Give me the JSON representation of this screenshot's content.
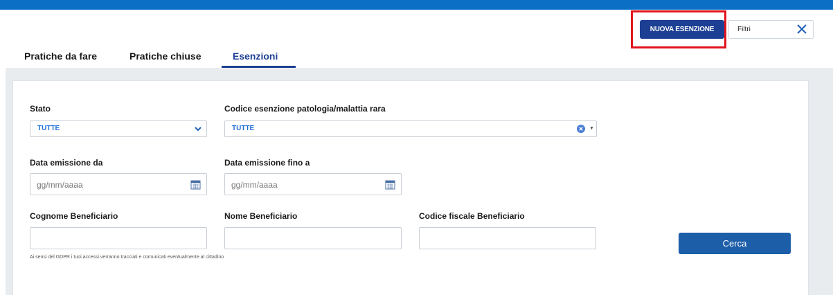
{
  "header": {
    "new_button_label": "NUOVA ESENZIONE",
    "filter_label": "Filtri"
  },
  "tabs": [
    {
      "label": "Pratiche da fare",
      "active": false
    },
    {
      "label": "Pratiche chiuse",
      "active": false
    },
    {
      "label": "Esenzioni",
      "active": true
    }
  ],
  "form": {
    "stato": {
      "label": "Stato",
      "value": "TUTTE"
    },
    "codice": {
      "label": "Codice esenzione patologia/malattia rara",
      "value": "TUTTE"
    },
    "data_da": {
      "label": "Data emissione da",
      "placeholder": "gg/mm/aaaa"
    },
    "data_a": {
      "label": "Data emissione fino a",
      "placeholder": "gg/mm/aaaa"
    },
    "cognome": {
      "label": "Cognome Beneficiario",
      "value": ""
    },
    "nome": {
      "label": "Nome Beneficiario",
      "value": ""
    },
    "codice_fiscale": {
      "label": "Codice fiscale Beneficiario",
      "value": ""
    },
    "gdpr_note": "Ai sensi del GDPR i tuoi accessi verranno tracciati e comunicati eventualmente al cittadino",
    "search_button": "Cerca"
  },
  "colors": {
    "brand_blue": "#1c3f94",
    "top_bar": "#0b70c5",
    "highlight_red": "#e1141b",
    "search_button": "#1d5ea8"
  },
  "icons": [
    "close-icon",
    "chevron-down-icon",
    "clear-circle-icon",
    "caret-down-icon",
    "calendar-icon"
  ]
}
